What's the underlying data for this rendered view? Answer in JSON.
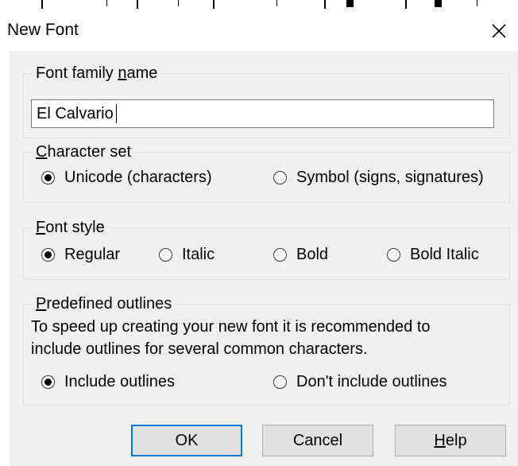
{
  "dialog": {
    "title": "New Font",
    "close_icon": "close-icon"
  },
  "font_family": {
    "legend_pre": "Font family ",
    "legend_u": "n",
    "legend_post": "ame",
    "value": "El Calvario"
  },
  "character_set": {
    "legend_u": "C",
    "legend_post": "haracter set",
    "options": [
      {
        "label": "Unicode (characters)",
        "selected": true
      },
      {
        "label": "Symbol (signs, signatures)",
        "selected": false
      }
    ]
  },
  "font_style": {
    "legend_u": "F",
    "legend_post": "ont style",
    "options": [
      {
        "label": "Regular",
        "selected": true
      },
      {
        "label": "Italic",
        "selected": false
      },
      {
        "label": "Bold",
        "selected": false
      },
      {
        "label": "Bold Italic",
        "selected": false
      }
    ]
  },
  "outlines": {
    "legend_u": "P",
    "legend_post": "redefined outlines",
    "description_line1": "To speed up creating your new font it is recommended to",
    "description_line2": "include outlines for several common characters.",
    "options": [
      {
        "label": "Include outlines",
        "selected": true
      },
      {
        "label": "Don't include outlines",
        "selected": false
      }
    ]
  },
  "buttons": {
    "ok": "OK",
    "cancel": "Cancel",
    "help_u": "H",
    "help_post": "elp"
  },
  "colors": {
    "client_bg": "#f0f0f0",
    "default_button_border": "#0078d7"
  }
}
